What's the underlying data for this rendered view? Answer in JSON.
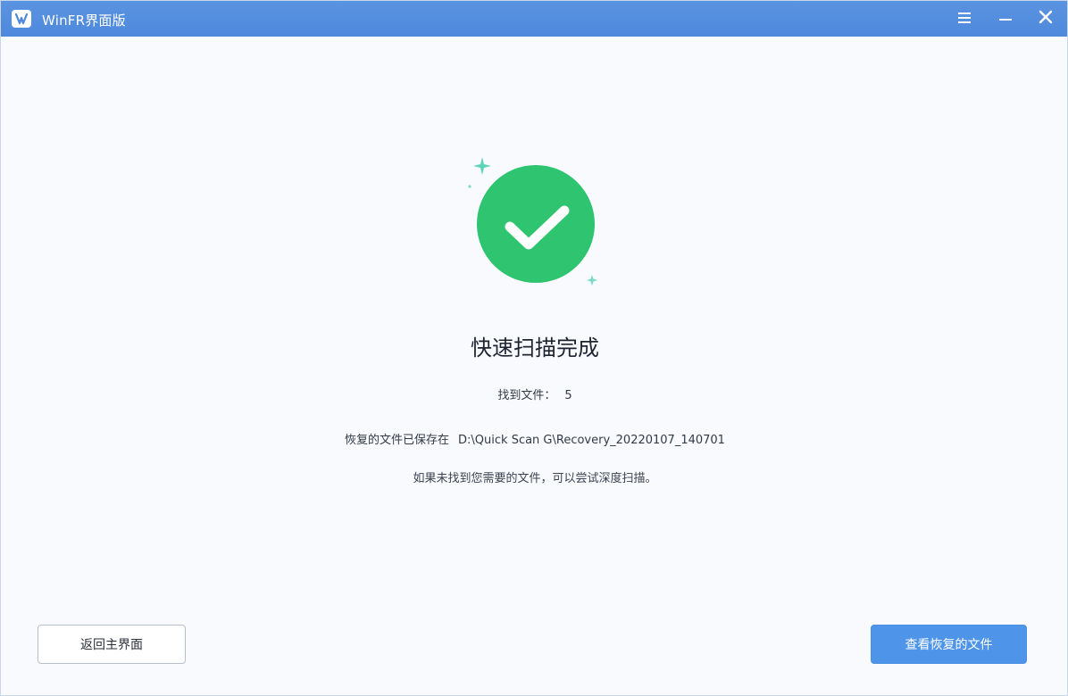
{
  "window": {
    "title": "WinFR界面版"
  },
  "colors": {
    "titlebar": "#4d88dc",
    "success": "#2fc46f",
    "primary_button": "#4e95ea"
  },
  "result": {
    "headline": "快速扫描完成",
    "found_label": "找到文件：",
    "found_count": "5",
    "saved_label": "恢复的文件已保存在",
    "saved_path": "D:\\Quick Scan G\\Recovery_20220107_140701",
    "hint": "如果未找到您需要的文件，可以尝试深度扫描。"
  },
  "buttons": {
    "back_label": "返回主界面",
    "view_label": "查看恢复的文件"
  },
  "icons": {
    "app": "app-logo-icon",
    "menu": "hamburger-menu-icon",
    "minimize": "minimize-icon",
    "close": "close-icon",
    "status": "checkmark-circle-icon"
  }
}
